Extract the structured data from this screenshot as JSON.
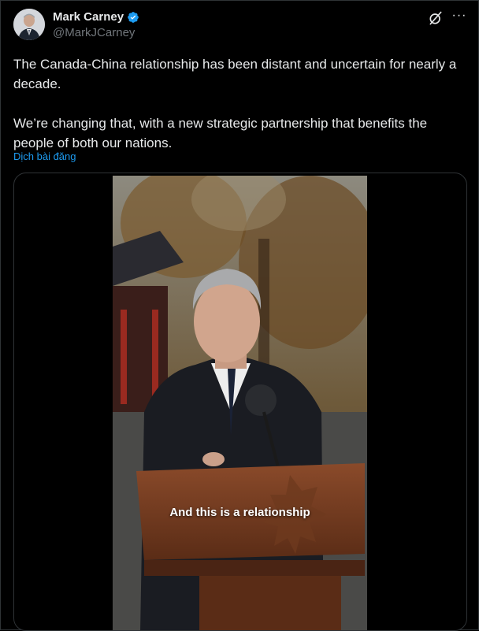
{
  "author": {
    "name": "Mark Carney",
    "handle": "@MarkJCarney",
    "verified_color": "#1d9bf0"
  },
  "icons": {
    "grok": "grok-icon",
    "more": "more-icon",
    "verified": "verified-badge-icon"
  },
  "tweet": {
    "paragraphs": [
      "The Canada-China relationship has been distant and uncertain for nearly a decade.",
      "We’re changing that, with a new strategic partnership that benefits the people of both our nations."
    ],
    "translate_label": "Dịch bài đăng"
  },
  "media": {
    "caption": "And this is a relationship"
  },
  "colors": {
    "background": "#000000",
    "text": "#e7e9ea",
    "muted": "#71767b",
    "link": "#1d9bf0"
  }
}
